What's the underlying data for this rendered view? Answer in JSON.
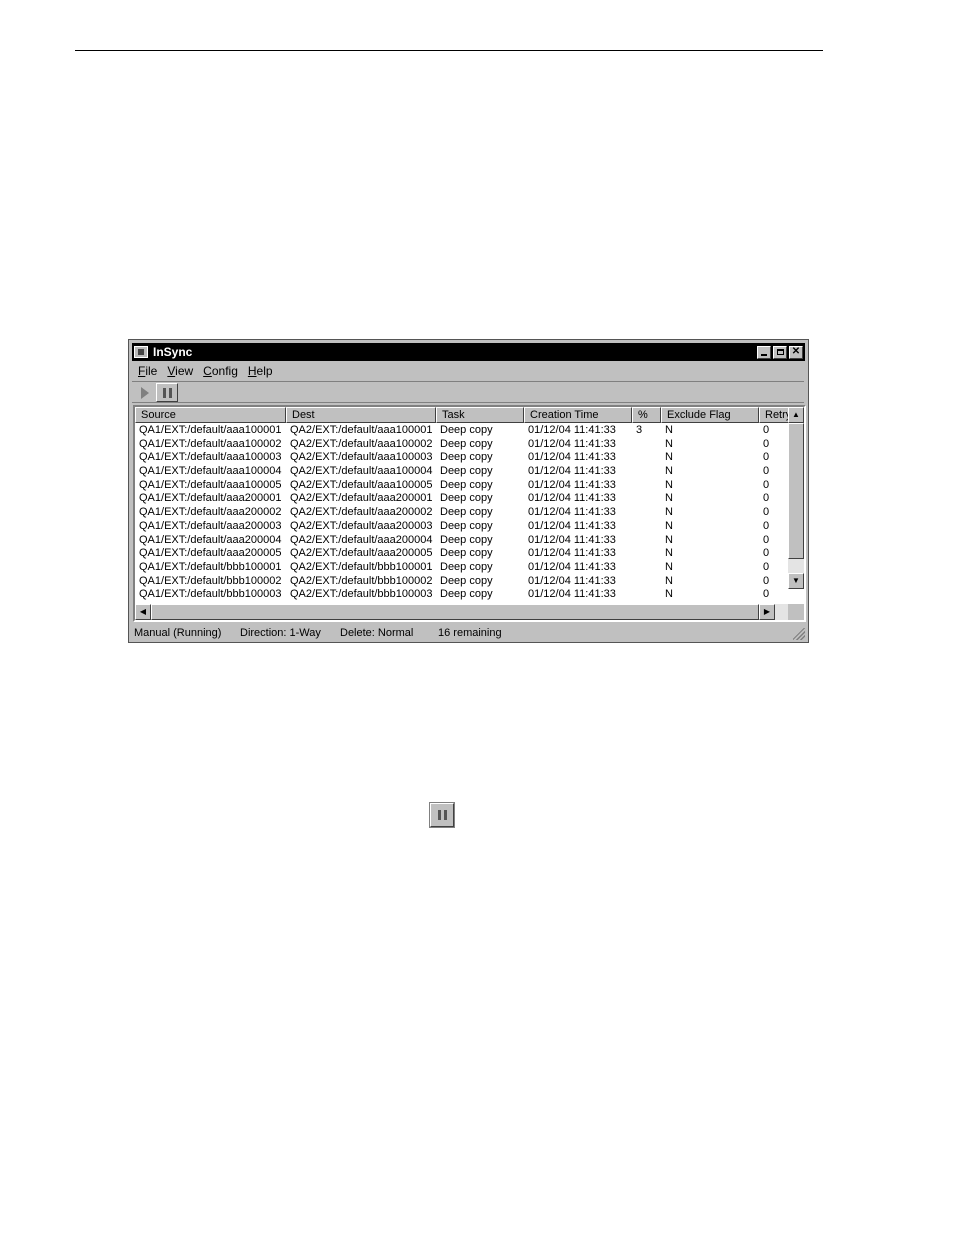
{
  "window": {
    "title": "InSync",
    "controls": {
      "minimize": "minimize",
      "maximize": "maximize",
      "close": "✕"
    }
  },
  "menu": [
    {
      "first": "F",
      "rest": "ile"
    },
    {
      "first": "V",
      "rest": "iew"
    },
    {
      "first": "C",
      "rest": "onfig"
    },
    {
      "first": "H",
      "rest": "elp"
    }
  ],
  "toolbar": {
    "play_icon": "play-icon",
    "pause_icon": "pause-icon"
  },
  "columns": [
    "Source",
    "Dest",
    "Task",
    "Creation Time",
    "%",
    "Exclude Flag",
    "Retry"
  ],
  "rows": [
    [
      "QA1/EXT:/default/aaa100001",
      "QA2/EXT:/default/aaa100001",
      "Deep copy",
      "01/12/04 11:41:33",
      "3",
      "N",
      "0"
    ],
    [
      "QA1/EXT:/default/aaa100002",
      "QA2/EXT:/default/aaa100002",
      "Deep copy",
      "01/12/04 11:41:33",
      "",
      "N",
      "0"
    ],
    [
      "QA1/EXT:/default/aaa100003",
      "QA2/EXT:/default/aaa100003",
      "Deep copy",
      "01/12/04 11:41:33",
      "",
      "N",
      "0"
    ],
    [
      "QA1/EXT:/default/aaa100004",
      "QA2/EXT:/default/aaa100004",
      "Deep copy",
      "01/12/04 11:41:33",
      "",
      "N",
      "0"
    ],
    [
      "QA1/EXT:/default/aaa100005",
      "QA2/EXT:/default/aaa100005",
      "Deep copy",
      "01/12/04 11:41:33",
      "",
      "N",
      "0"
    ],
    [
      "QA1/EXT:/default/aaa200001",
      "QA2/EXT:/default/aaa200001",
      "Deep copy",
      "01/12/04 11:41:33",
      "",
      "N",
      "0"
    ],
    [
      "QA1/EXT:/default/aaa200002",
      "QA2/EXT:/default/aaa200002",
      "Deep copy",
      "01/12/04 11:41:33",
      "",
      "N",
      "0"
    ],
    [
      "QA1/EXT:/default/aaa200003",
      "QA2/EXT:/default/aaa200003",
      "Deep copy",
      "01/12/04 11:41:33",
      "",
      "N",
      "0"
    ],
    [
      "QA1/EXT:/default/aaa200004",
      "QA2/EXT:/default/aaa200004",
      "Deep copy",
      "01/12/04 11:41:33",
      "",
      "N",
      "0"
    ],
    [
      "QA1/EXT:/default/aaa200005",
      "QA2/EXT:/default/aaa200005",
      "Deep copy",
      "01/12/04 11:41:33",
      "",
      "N",
      "0"
    ],
    [
      "QA1/EXT:/default/bbb100001",
      "QA2/EXT:/default/bbb100001",
      "Deep copy",
      "01/12/04 11:41:33",
      "",
      "N",
      "0"
    ],
    [
      "QA1/EXT:/default/bbb100002",
      "QA2/EXT:/default/bbb100002",
      "Deep copy",
      "01/12/04 11:41:33",
      "",
      "N",
      "0"
    ],
    [
      "QA1/EXT:/default/bbb100003",
      "QA2/EXT:/default/bbb100003",
      "Deep copy",
      "01/12/04 11:41:33",
      "",
      "N",
      "0"
    ]
  ],
  "status": {
    "mode": "Manual (Running)",
    "direction": "Direction: 1-Way",
    "delete": "Delete: Normal",
    "remaining": "16 remaining"
  },
  "inline_icon": "pause-icon"
}
